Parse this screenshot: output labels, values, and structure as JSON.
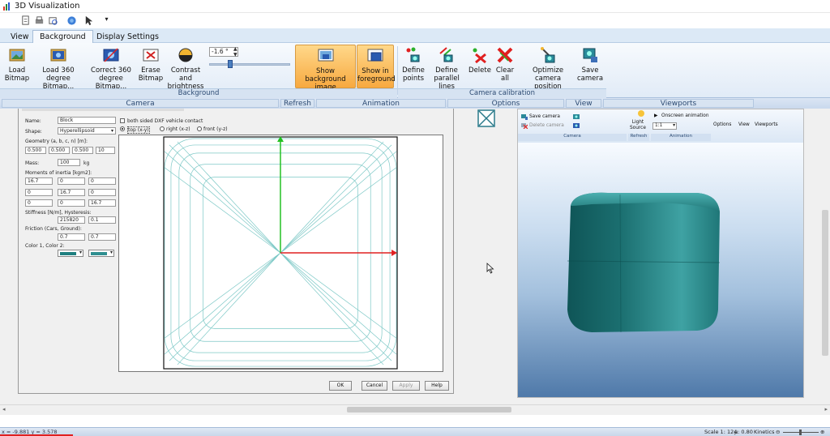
{
  "window": {
    "title": "3D Visualization"
  },
  "tabs": [
    "View",
    "Background",
    "Display Settings"
  ],
  "ribbon": {
    "background_buttons": [
      {
        "label": "Load\nBitmap",
        "icon": "load-bitmap-icon"
      },
      {
        "label": "Load 360 degree\nBitmap...",
        "icon": "load-360-bitmap-icon"
      },
      {
        "label": "Correct 360\ndegree Bitmap...",
        "icon": "correct-360-bitmap-icon"
      },
      {
        "label": "Erase\nBitmap",
        "icon": "erase-bitmap-icon"
      },
      {
        "label": "Contrast and\nbrightness",
        "icon": "contrast-icon"
      }
    ],
    "spinner_value": "-1.6 °",
    "show_buttons": [
      {
        "label": "Show background\nimage",
        "icon": "show-background-icon",
        "active": true
      },
      {
        "label": "Show in\nforeground",
        "icon": "show-foreground-icon",
        "active": true
      }
    ],
    "calibration_buttons": [
      {
        "label": "Define\npoints",
        "icon": "define-points-icon"
      },
      {
        "label": "Define\nparallel lines",
        "icon": "define-lines-icon"
      },
      {
        "label": "Delete",
        "icon": "delete-icon"
      },
      {
        "label": "Clear\nall",
        "icon": "clear-all-icon"
      },
      {
        "label": "Optimize camera\nposition",
        "icon": "optimize-camera-icon"
      },
      {
        "label": "Save\ncamera",
        "icon": "save-camera-icon"
      }
    ],
    "groups": {
      "background": "Background",
      "calibration": "Camera calibration"
    }
  },
  "bar2": [
    "Camera",
    "Refresh",
    "Animation",
    "Options",
    "View",
    "Viewports"
  ],
  "dialog": {
    "name_label": "Name:",
    "name_value": "Block",
    "shape_label": "Shape:",
    "shape_value": "Hyperellipsoid",
    "geometry_label": "Geometry (a, b, c, n) [m]:",
    "geometry_values": [
      "0.500",
      "0.500",
      "0.500",
      "10"
    ],
    "mass_label": "Mass:",
    "mass_value": "100",
    "mass_unit": "kg",
    "inertia_label": "Moments of inertia [kgm2]:",
    "inertia_values": [
      [
        "16.7",
        "0",
        "0"
      ],
      [
        "0",
        "16.7",
        "0"
      ],
      [
        "0",
        "0",
        "16.7"
      ]
    ],
    "stiffness_label": "Stiffness [N/m], Hysteresis:",
    "stiffness_values": [
      "215820",
      "0.1"
    ],
    "friction_label": "Friction (Cars, Ground):",
    "friction_values": [
      "0.7",
      "0.7"
    ],
    "color_label": "Color 1, Color 2:",
    "checkbox_label": "both sided DXF vehicle contact",
    "views": [
      "top (x-y)",
      "right (x-z)",
      "front (y-z)"
    ],
    "buttons": [
      "OK",
      "Cancel",
      "Apply",
      "Help"
    ],
    "accent": {
      "color1": "#1f7f80",
      "color2": "#2f8f90"
    }
  },
  "inner": {
    "save_camera": "Save camera",
    "delete_camera": "Delete camera",
    "light_source": "Light\nSource",
    "onscreen_animation": "Onscreen animation",
    "ratio": "1:1",
    "options": "Options",
    "view": "View",
    "viewports": "Viewports",
    "groups": [
      "Camera",
      "Refresh",
      "Animation"
    ]
  },
  "status": {
    "coords": "x = -9.881 y = 3.578",
    "scale": "Scale 1: 124",
    "mu": "µ: 0.80",
    "mode": "Kinetics"
  },
  "colors": {
    "cube": "#1b6f70",
    "axis_x": "#e02020",
    "axis_y": "#22c022",
    "wire": "#7cc8c6"
  }
}
